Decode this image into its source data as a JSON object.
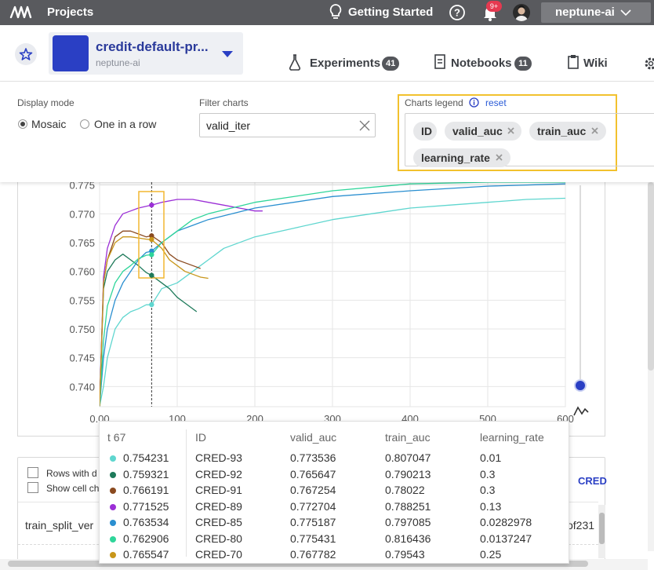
{
  "topbar": {
    "projects_label": "Projects",
    "getting_started_label": "Getting Started",
    "notification_count": "9+",
    "org_name": "neptune-ai"
  },
  "project": {
    "name": "credit-default-pr...",
    "org": "neptune-ai",
    "color": "#2a3fc4"
  },
  "nav": {
    "experiments": {
      "label": "Experiments",
      "count": "41"
    },
    "notebooks": {
      "label": "Notebooks",
      "count": "11"
    },
    "wiki": {
      "label": "Wiki"
    }
  },
  "controls": {
    "display_mode_label": "Display mode",
    "mosaic_label": "Mosaic",
    "one_in_row_label": "One in a row",
    "selected_mode": "Mosaic",
    "filter_label": "Filter charts",
    "filter_value": "valid_iter",
    "legend_label": "Charts legend",
    "reset_label": "reset",
    "legend_chips": [
      "ID",
      "valid_auc",
      "train_auc",
      "learning_rate"
    ]
  },
  "chart_data": {
    "type": "line",
    "x_ticks": [
      "0.00",
      "100",
      "200",
      "300",
      "400",
      "500",
      "600"
    ],
    "y_ticks": [
      "0.740",
      "0.745",
      "0.750",
      "0.755",
      "0.760",
      "0.765",
      "0.770",
      "0.775"
    ],
    "xlim": [
      0,
      600
    ],
    "ylim": [
      0.7365,
      0.7755
    ],
    "hover_x": 67,
    "series": [
      {
        "color": "#5fd6cf",
        "x": [
          0,
          5,
          10,
          20,
          30,
          40,
          50,
          60,
          67,
          80,
          100,
          120,
          140,
          160,
          200,
          250,
          300,
          350,
          400,
          450,
          500,
          550,
          600
        ],
        "y": [
          0.7366,
          0.74,
          0.745,
          0.75,
          0.752,
          0.753,
          0.7535,
          0.7542,
          0.7542,
          0.757,
          0.758,
          0.76,
          0.762,
          0.764,
          0.766,
          0.7675,
          0.769,
          0.77,
          0.771,
          0.7715,
          0.772,
          0.7725,
          0.7727
        ]
      },
      {
        "color": "#1e7a5a",
        "x": [
          0,
          5,
          10,
          20,
          30,
          40,
          50,
          60,
          67,
          80,
          90,
          100,
          110,
          125
        ],
        "y": [
          0.7366,
          0.757,
          0.76,
          0.762,
          0.763,
          0.762,
          0.761,
          0.7598,
          0.7593,
          0.758,
          0.757,
          0.7555,
          0.7545,
          0.753
        ]
      },
      {
        "color": "#8a4a1f",
        "x": [
          0,
          5,
          10,
          20,
          30,
          40,
          50,
          60,
          67,
          80,
          90,
          100,
          110,
          120,
          130
        ],
        "y": [
          0.7366,
          0.758,
          0.762,
          0.766,
          0.767,
          0.767,
          0.7665,
          0.766,
          0.7662,
          0.765,
          0.763,
          0.762,
          0.7615,
          0.761,
          0.7605
        ]
      },
      {
        "color": "#9b2fd6",
        "x": [
          0,
          5,
          10,
          20,
          30,
          40,
          50,
          60,
          67,
          80,
          100,
          120,
          140,
          160,
          180,
          200,
          210
        ],
        "y": [
          0.7366,
          0.759,
          0.764,
          0.768,
          0.77,
          0.7705,
          0.771,
          0.7713,
          0.7715,
          0.772,
          0.7725,
          0.7725,
          0.772,
          0.7715,
          0.771,
          0.7705,
          0.7705
        ]
      },
      {
        "color": "#2a8fd0",
        "x": [
          0,
          5,
          10,
          20,
          30,
          40,
          50,
          60,
          67,
          80,
          100,
          120,
          140,
          200,
          300,
          400,
          500,
          600
        ],
        "y": [
          0.7366,
          0.745,
          0.75,
          0.755,
          0.758,
          0.76,
          0.762,
          0.7633,
          0.7635,
          0.765,
          0.767,
          0.768,
          0.769,
          0.771,
          0.773,
          0.774,
          0.7748,
          0.7752
        ]
      },
      {
        "color": "#2fd59a",
        "x": [
          0,
          5,
          10,
          20,
          30,
          40,
          50,
          60,
          67,
          80,
          100,
          120,
          140,
          200,
          300,
          400,
          500,
          600
        ],
        "y": [
          0.7366,
          0.748,
          0.754,
          0.758,
          0.76,
          0.761,
          0.7622,
          0.7628,
          0.7629,
          0.765,
          0.767,
          0.769,
          0.77,
          0.772,
          0.774,
          0.7752,
          0.7755,
          0.7755
        ]
      },
      {
        "color": "#c8961a",
        "x": [
          0,
          5,
          10,
          20,
          30,
          40,
          50,
          60,
          67,
          80,
          90,
          100,
          110,
          120,
          130,
          140
        ],
        "y": [
          0.7366,
          0.758,
          0.762,
          0.765,
          0.766,
          0.766,
          0.7658,
          0.7656,
          0.7655,
          0.764,
          0.762,
          0.761,
          0.76,
          0.7595,
          0.759,
          0.7588
        ]
      }
    ]
  },
  "tooltip": {
    "x_label": "t 67",
    "headers": [
      "ID",
      "valid_auc",
      "train_auc",
      "learning_rate"
    ],
    "rows": [
      {
        "value": "0.754231",
        "id": "CRED-93",
        "valid_auc": "0.773536",
        "train_auc": "0.807047",
        "learning_rate": "0.01",
        "color": "#5fd6cf"
      },
      {
        "value": "0.759321",
        "id": "CRED-92",
        "valid_auc": "0.765647",
        "train_auc": "0.790213",
        "learning_rate": "0.3",
        "color": "#1e7a5a"
      },
      {
        "value": "0.766191",
        "id": "CRED-91",
        "valid_auc": "0.767254",
        "train_auc": "0.78022",
        "learning_rate": "0.3",
        "color": "#8a4a1f"
      },
      {
        "value": "0.771525",
        "id": "CRED-89",
        "valid_auc": "0.772704",
        "train_auc": "0.788251",
        "learning_rate": "0.13",
        "color": "#9b2fd6"
      },
      {
        "value": "0.763534",
        "id": "CRED-85",
        "valid_auc": "0.775187",
        "train_auc": "0.797085",
        "learning_rate": "0.0282978",
        "color": "#2a8fd0"
      },
      {
        "value": "0.762906",
        "id": "CRED-80",
        "valid_auc": "0.775431",
        "train_auc": "0.816436",
        "learning_rate": "0.0137247",
        "color": "#2fd59a"
      },
      {
        "value": "0.765547",
        "id": "CRED-70",
        "valid_auc": "0.767782",
        "train_auc": "0.79543",
        "learning_rate": "0.25",
        "color": "#c8961a"
      }
    ]
  },
  "table": {
    "rows_with_label": "Rows with d",
    "show_cell_label": "Show cell ch",
    "cred_header": "CRED",
    "row_param": "train_split_ver",
    "row_value_right": "of231"
  }
}
